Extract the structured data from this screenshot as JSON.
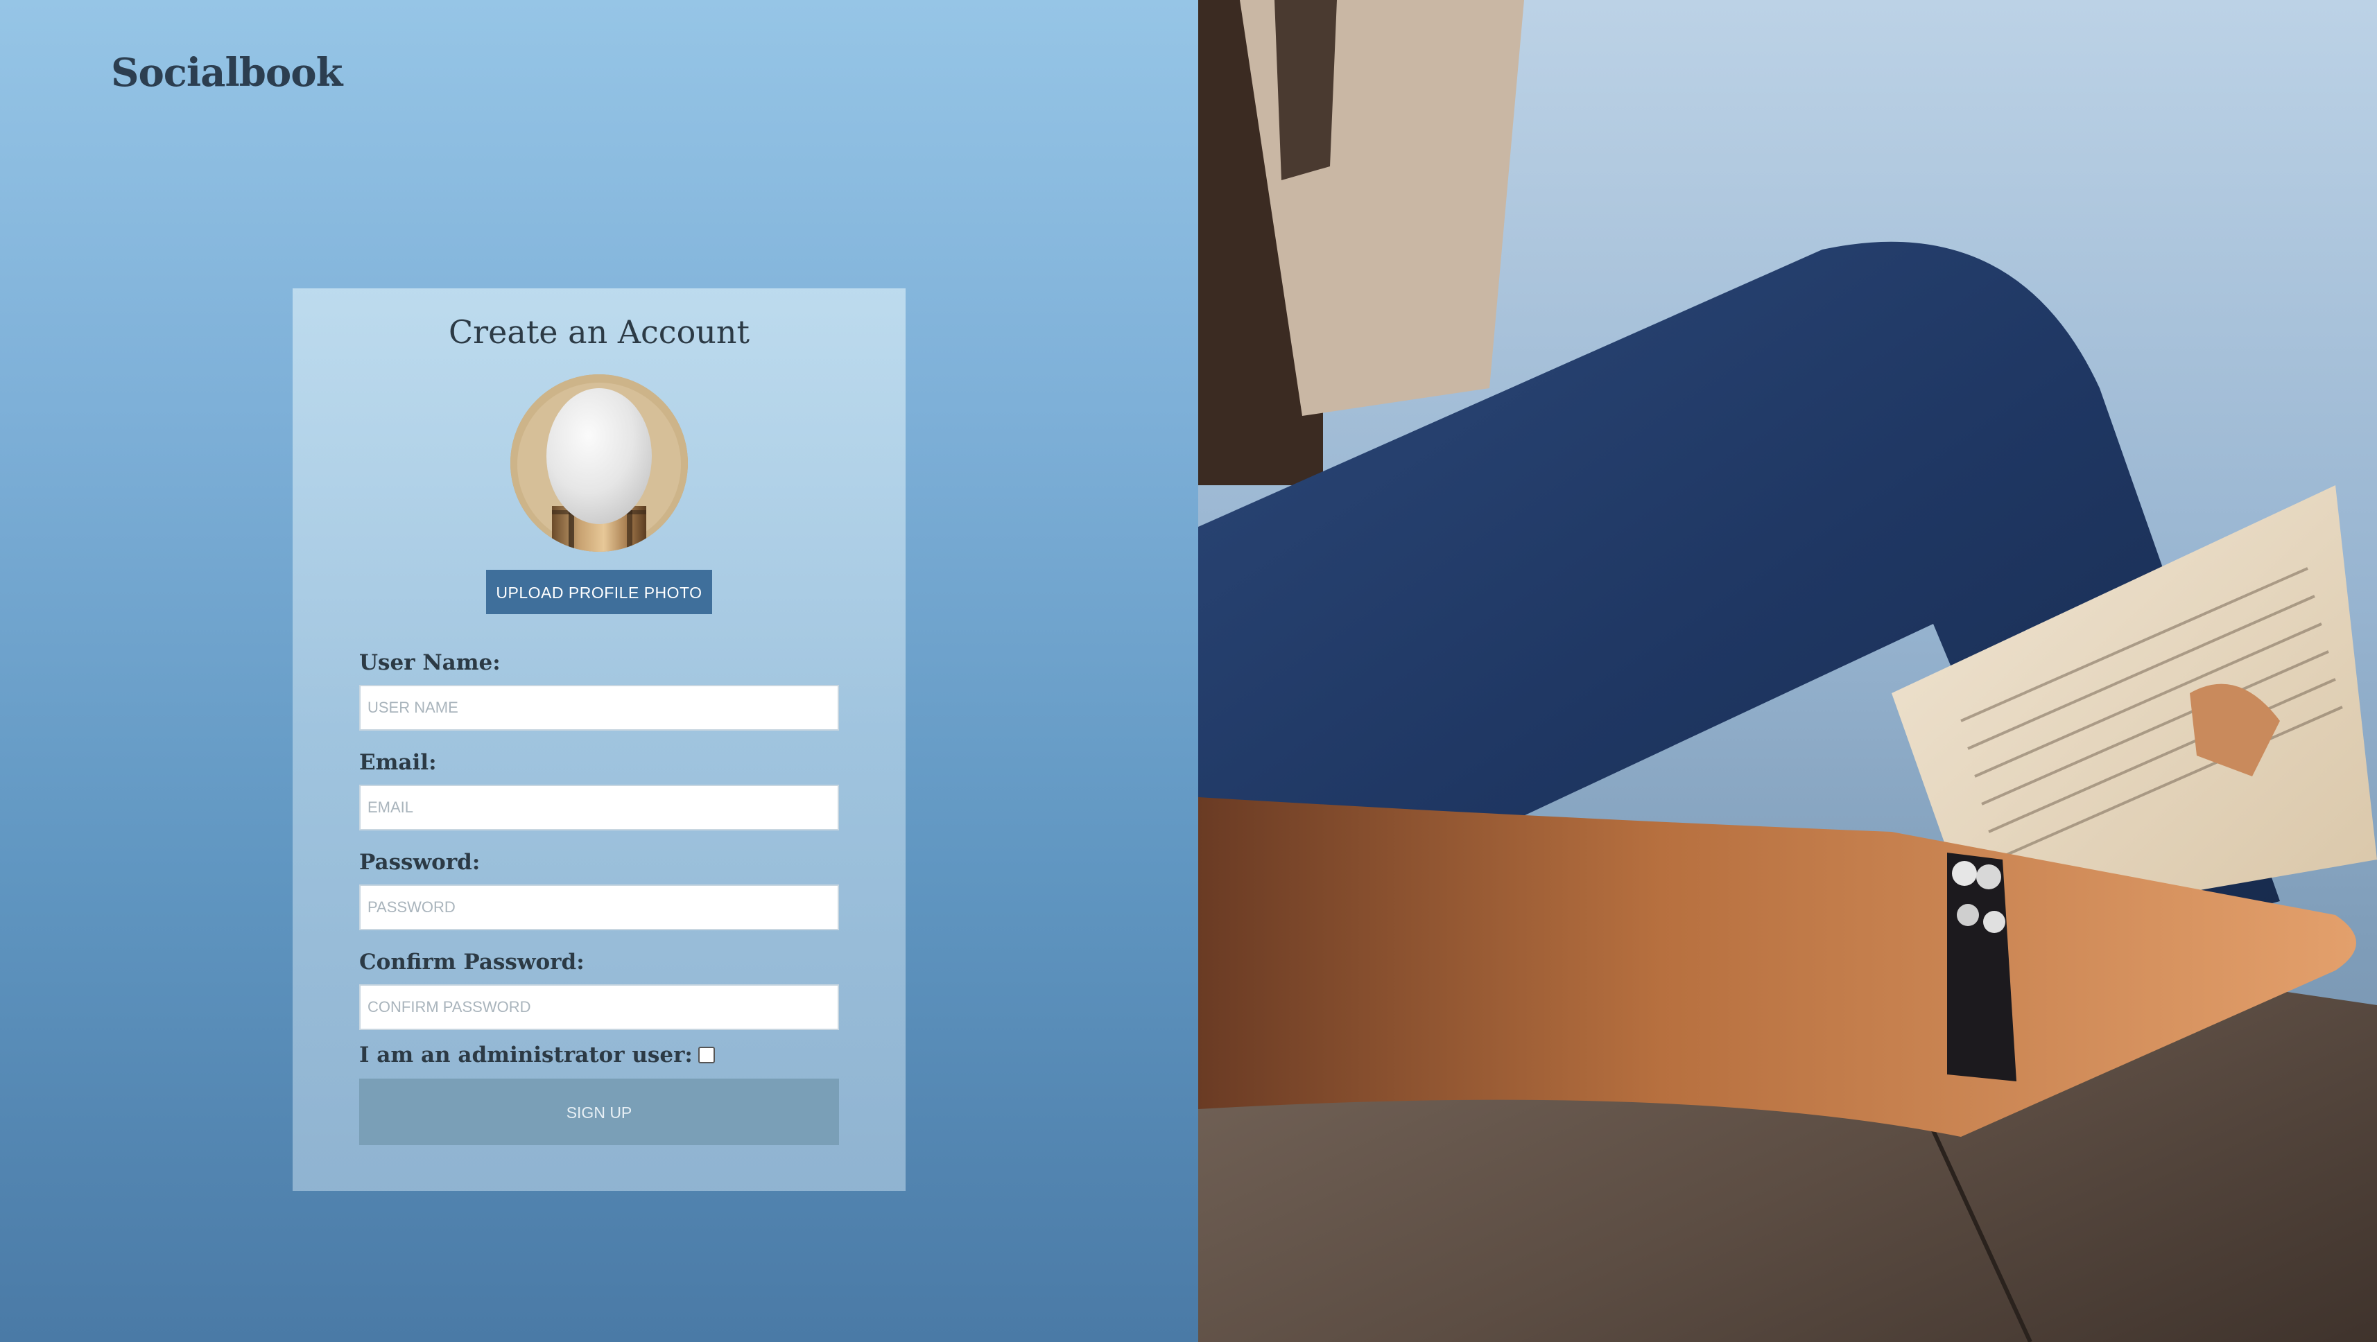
{
  "app": {
    "brand": "Socialbook"
  },
  "form": {
    "title": "Create an Account",
    "upload_label": "UPLOAD PROFILE PHOTO",
    "fields": [
      {
        "label": "User Name:",
        "placeholder": "USER NAME"
      },
      {
        "label": "Email:",
        "placeholder": "EMAIL"
      },
      {
        "label": "Password:",
        "placeholder": "PASSWORD"
      },
      {
        "label": "Confirm Password:",
        "placeholder": "CONFIRM PASSWORD"
      }
    ],
    "admin_label": "I am an administrator user:",
    "admin_checked": false,
    "signup_label": "SIGN UP"
  },
  "colors": {
    "accent": "#3f6f9b",
    "signup_button": "#7a9fb7",
    "heading_text": "#2c3a45"
  },
  "images": {
    "avatar": "egg-avatar-image",
    "hero": "woman-reading-book-photo"
  }
}
